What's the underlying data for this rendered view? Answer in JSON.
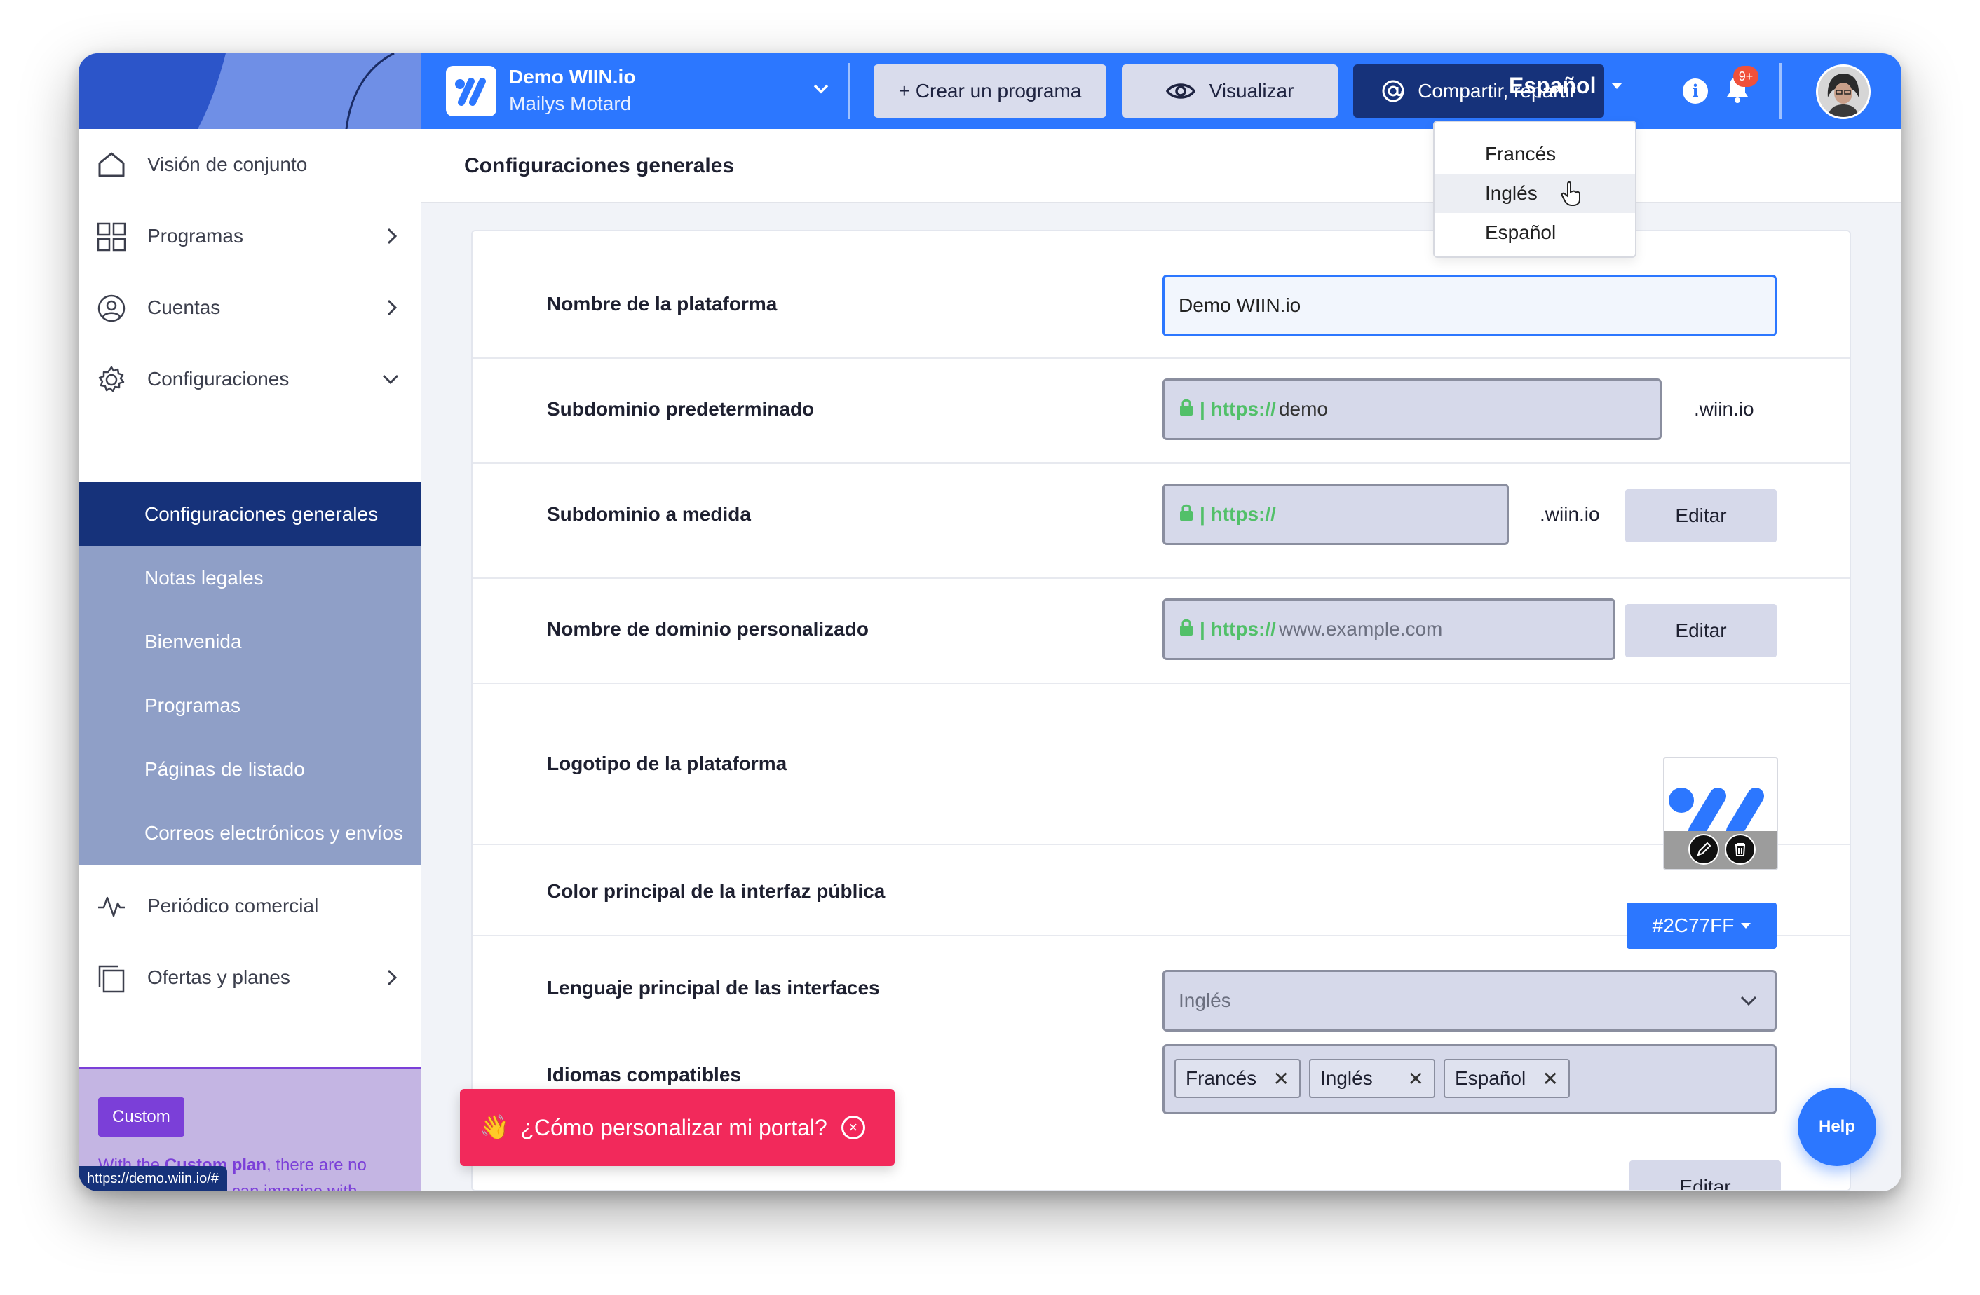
{
  "topbar": {
    "platform_name": "Demo WIIN.io",
    "user_name": "Mailys Motard",
    "create_program": "+ Crear un programa",
    "preview": "Visualizar",
    "share": "Compartir, repartir",
    "language": "Español",
    "notifications_badge": "9+"
  },
  "language_menu": {
    "items": [
      "Francés",
      "Inglés",
      "Español"
    ],
    "hovered": "Inglés"
  },
  "sidebar": {
    "items": [
      {
        "label": "Visión de conjunto",
        "icon": "home-icon"
      },
      {
        "label": "Programas",
        "icon": "grid-icon"
      },
      {
        "label": "Cuentas",
        "icon": "user-circle-icon"
      },
      {
        "label": "Configuraciones",
        "icon": "gear-icon"
      }
    ],
    "submenu": [
      "Configuraciones generales",
      "Notas legales",
      "Bienvenida",
      "Programas",
      "Páginas de listado",
      "Correos electrónicos y envíos"
    ],
    "items_after": [
      {
        "label": "Periódico comercial",
        "icon": "activity-icon"
      },
      {
        "label": "Ofertas y planes",
        "icon": "copy-icon"
      }
    ],
    "plan": {
      "tag": "Custom",
      "text_before": "With the ",
      "text_bold": "Custom plan",
      "text_after": ", there are no limits to what you can imagine with WIIN.io. Custom our project"
    },
    "status_url": "https://demo.wiin.io/#"
  },
  "page": {
    "title": "Configuraciones generales"
  },
  "form": {
    "platform_name_label": "Nombre de la plataforma",
    "platform_name_value": "Demo WIIN.io",
    "default_subdomain_label": "Subdominio predeterminado",
    "default_subdomain_proto": "| https://",
    "default_subdomain_value": "demo",
    "default_subdomain_suffix": ".wiin.io",
    "custom_subdomain_label": "Subdominio a medida",
    "custom_subdomain_proto": "| https://",
    "custom_subdomain_suffix": ".wiin.io",
    "edit_label": "Editar",
    "custom_domain_label": "Nombre de dominio personalizado",
    "custom_domain_proto": "| https://",
    "custom_domain_placeholder": "www.example.com",
    "logo_label": "Logotipo de la plataforma",
    "color_label": "Color principal de la interfaz pública",
    "color_value": "#2C77FF",
    "main_language_label": "Lenguaje principal de las interfaces",
    "main_language_value": "Inglés",
    "supported_languages_label": "Idiomas compatibles",
    "supported_languages": [
      "Francés",
      "Inglés",
      "Español"
    ],
    "tag_remove": "✕"
  },
  "toast": {
    "emoji": "👋",
    "text": "¿Cómo personalizar mi portal?"
  },
  "help_label": "Help",
  "colors": {
    "primary": "#2C77FF",
    "navy": "#16327A",
    "submenu": "#8F9FC7",
    "plan_purple": "#7B3FD8",
    "toast_red": "#F2295B",
    "lock_green": "#52C069"
  }
}
